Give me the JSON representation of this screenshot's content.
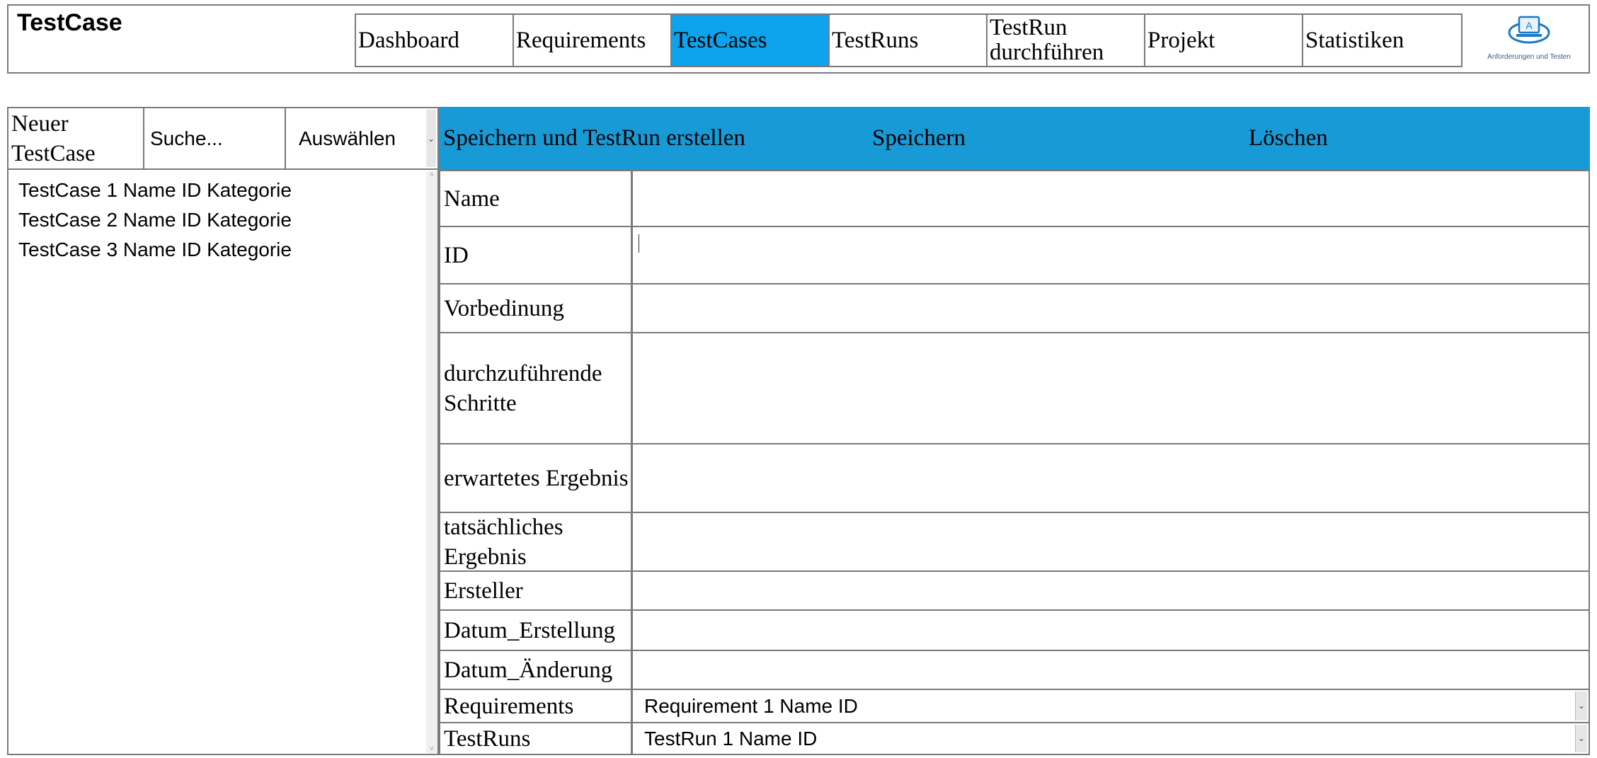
{
  "page": {
    "title": "TestCase"
  },
  "nav": {
    "items": [
      {
        "label": "Dashboard"
      },
      {
        "label": "Requirements"
      },
      {
        "label": "TestCases"
      },
      {
        "label": "TestRuns"
      },
      {
        "label": "TestRun durchführen"
      },
      {
        "label": "Projekt"
      },
      {
        "label": "Statistiken"
      }
    ],
    "active": "TestCases",
    "active_color": "#0aa3ec"
  },
  "logo": {
    "caption": "Anforderungen und Testen",
    "icon": "laptop-a-logo"
  },
  "left": {
    "new_button": "Neuer TestCase",
    "search_placeholder": "Suche...",
    "select_label": "Auswählen",
    "list": [
      "TestCase 1 Name ID Kategorie",
      "TestCase 2 Name ID Kategorie",
      "TestCase 3 Name ID Kategorie"
    ]
  },
  "actions": {
    "save_and_create": "Speichern und TestRun erstellen",
    "save": "Speichern",
    "delete": "Löschen",
    "bar_color": "#189ad6"
  },
  "form": {
    "name": "Name",
    "id": "ID",
    "precondition": "Vorbedinung",
    "steps": "durchzuführende Schritte",
    "expected": "erwartetes Ergebnis",
    "actual": "tatsächliches Ergebnis",
    "creator": "Ersteller",
    "created": "Datum_Erstellung",
    "modified": "Datum_Änderung",
    "requirements": "Requirements",
    "requirements_value": "Requirement 1 Name ID",
    "testruns": "TestRuns",
    "testruns_value": "TestRun 1 Name ID"
  }
}
